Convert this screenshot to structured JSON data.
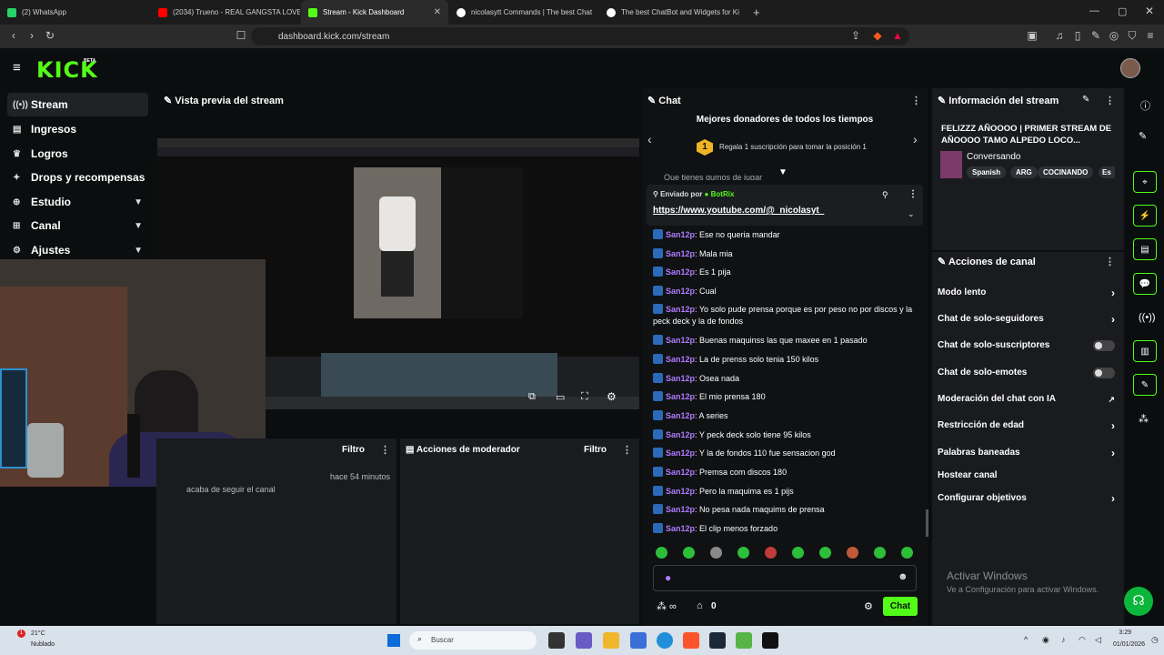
{
  "browser": {
    "tabs": [
      {
        "label": "(2) WhatsApp",
        "color": "#25d366"
      },
      {
        "label": "(2034) Trueno - REAL GANGSTA LOVE",
        "color": "#ff0000"
      },
      {
        "label": "Stream - Kick Dashboard",
        "color": "#53fc18"
      },
      {
        "label": "nicolasytt Commands | The best Chat",
        "color": "#ffffff"
      },
      {
        "label": "The best ChatBot and Widgets for Ki",
        "color": "#ffffff"
      }
    ],
    "url": "dashboard.kick.com/stream"
  },
  "header": {
    "logo": "KICK",
    "beta": "BETA"
  },
  "sidebar": {
    "items": [
      {
        "label": "Stream",
        "icon": "stream-icon"
      },
      {
        "label": "Ingresos",
        "icon": "money-icon"
      },
      {
        "label": "Logros",
        "icon": "trophy-icon"
      },
      {
        "label": "Drops y recompensas",
        "icon": "gift-icon"
      },
      {
        "label": "Estudio",
        "icon": "studio-icon"
      },
      {
        "label": "Canal",
        "icon": "channel-icon"
      },
      {
        "label": "Ajustes",
        "icon": "gear-icon"
      }
    ]
  },
  "preview": {
    "title": "Vista previa del stream"
  },
  "activity": {
    "filter": "Filtro",
    "time": "hace 54 minutos",
    "text": "acaba de seguir el canal"
  },
  "modactions": {
    "title": "Acciones de moderador",
    "filter": "Filtro"
  },
  "chat": {
    "title": "Chat",
    "donors_title": "Mejores donadores de todos los tiempos",
    "donor_rank": "1",
    "donor_text": "Regala 1 suscripción para tomar la posición 1",
    "pinned_partial": "Que tienes gumos de jugar",
    "pinned_by_label": "Enviado por",
    "pinned_by_user": "BotRix",
    "pinned_link": "https://www.youtube.com/@_nicolasyt_",
    "username": "San12p",
    "messages": [
      "Ese no queria mandar",
      "Mala mia",
      "Es 1 pija",
      "Cual",
      "Yo solo pude prensa porque es por peso no por discos y la peck deck y la de fondos",
      "Buenas maquinss las que maxee en 1 pasado",
      "La de prenss solo tenia 150 kilos",
      "Osea nada",
      "El mio prensa 180",
      "A series",
      "Y peck deck solo tiene 95 kilos",
      "Y la de fondos 110 fue sensacion god",
      "Premsa com discos 180",
      "Pero la maquima es 1 pijs",
      "No pesa nada maquims de prensa",
      "El clip menos forzado"
    ],
    "points": "0",
    "send": "Chat"
  },
  "info": {
    "title": "Información del stream",
    "stream_title": "FELIZZZ AÑOOOO | PRIMER STREAM DE AÑOOOO TAMO ALPEDO LOCO...",
    "category": "Conversando",
    "tags": [
      "Spanish",
      "ARG",
      "COCINANDO",
      "Es"
    ]
  },
  "actions": {
    "title": "Acciones de canal",
    "items": [
      {
        "label": "Modo lento",
        "type": "chevron"
      },
      {
        "label": "Chat de solo-seguidores",
        "type": "chevron"
      },
      {
        "label": "Chat de solo-suscriptores",
        "type": "toggle"
      },
      {
        "label": "Chat de solo-emotes",
        "type": "toggle"
      },
      {
        "label": "Moderación del chat con IA",
        "type": "link"
      },
      {
        "label": "Restricción de edad",
        "type": "chevron"
      },
      {
        "label": "Palabras baneadas",
        "type": "chevron"
      },
      {
        "label": "Hostear canal",
        "type": "none"
      },
      {
        "label": "Configurar objetivos",
        "type": "chevron"
      }
    ]
  },
  "watermark": {
    "title": "Activar Windows",
    "sub": "Ve a Configuración para activar Windows."
  },
  "taskbar": {
    "weather_temp": "21°C",
    "weather_text": "Nublado",
    "search": "Buscar",
    "time": "3:29",
    "date": "01/01/2026"
  },
  "colors": {
    "accent": "#53fc18",
    "username": "#b07cff"
  }
}
